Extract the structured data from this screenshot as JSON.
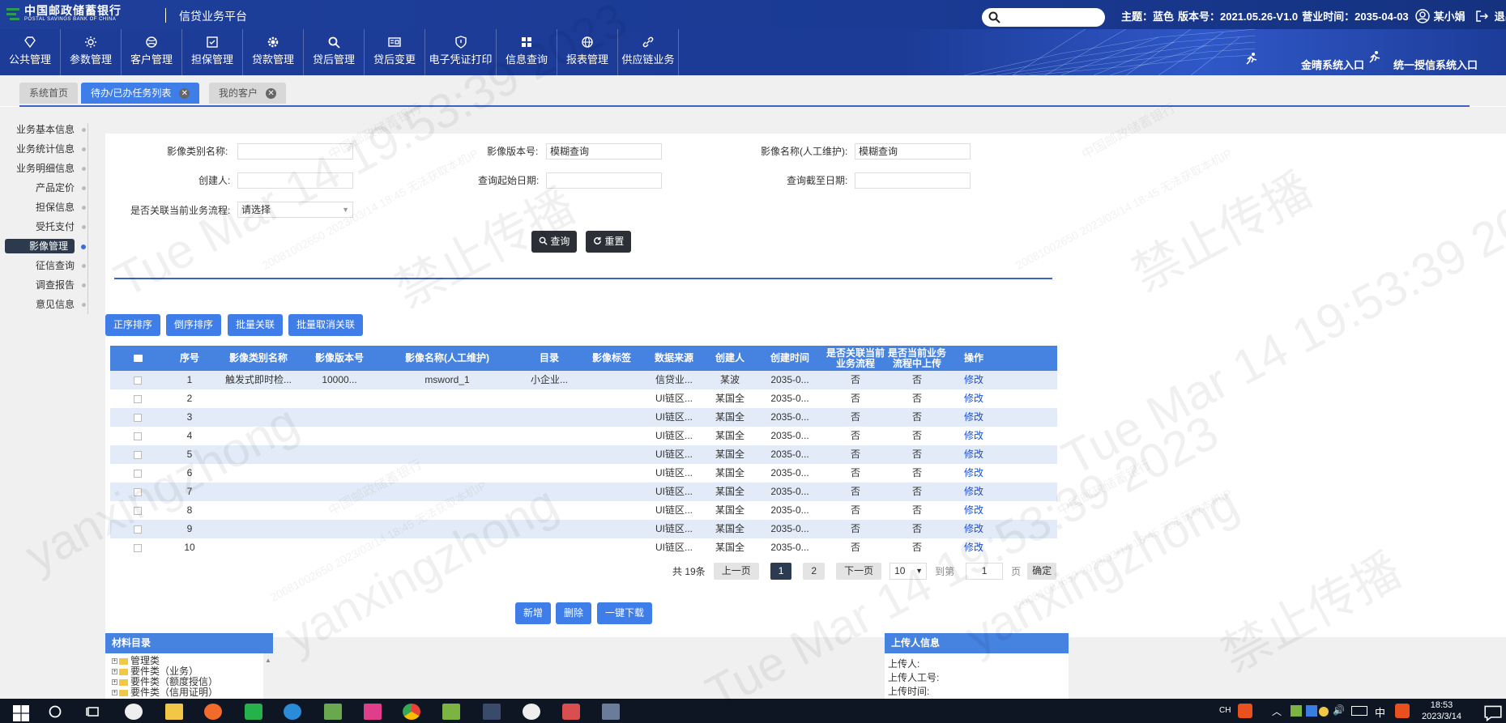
{
  "header": {
    "bank_name_cn": "中国邮政储蓄银行",
    "bank_name_en": "POSTAL SAVINGS BANK OF CHINA",
    "platform": "信贷业务平台",
    "search_placeholder": "",
    "theme": "主题：蓝色",
    "version": "版本号：2021.05.26-V1.0",
    "biz_time": "营业时间：2035-04-03",
    "user": "某小娟",
    "logout": "退出"
  },
  "nav": {
    "items": [
      {
        "label": "公共管理",
        "icon": "diamond-icon"
      },
      {
        "label": "参数管理",
        "icon": "gear-sun-icon"
      },
      {
        "label": "客户管理",
        "icon": "ball-icon"
      },
      {
        "label": "担保管理",
        "icon": "checklist-icon"
      },
      {
        "label": "贷款管理",
        "icon": "gear-icon"
      },
      {
        "label": "贷后管理",
        "icon": "search-icon"
      },
      {
        "label": "贷后变更",
        "icon": "card-icon"
      },
      {
        "label": "电子凭证打印",
        "icon": "shield-icon"
      },
      {
        "label": "信息查询",
        "icon": "grid-icon"
      },
      {
        "label": "报表管理",
        "icon": "globe-icon"
      },
      {
        "label": "供应链业务",
        "icon": "link-icon"
      }
    ],
    "entry1": "金晴系统入口",
    "entry2": "统一授信系统入口"
  },
  "tabs": [
    {
      "label": "系统首页",
      "active": false,
      "closable": false
    },
    {
      "label": "待办/已办任务列表",
      "active": true,
      "closable": true
    },
    {
      "label": "我的客户",
      "active": false,
      "closable": true
    }
  ],
  "sidebar": {
    "items": [
      "业务基本信息",
      "业务统计信息",
      "业务明细信息",
      "产品定价",
      "担保信息",
      "受托支付",
      "影像管理",
      "征信查询",
      "调查报告",
      "意见信息"
    ],
    "active_index": 6
  },
  "form": {
    "label_category": "影像类别名称:",
    "value_category": "",
    "label_version": "影像版本号:",
    "value_version": "模糊查询",
    "label_name": "影像名称(人工维护):",
    "value_name": "模糊查询",
    "label_creator": "创建人:",
    "value_creator": "",
    "label_start": "查询起始日期:",
    "value_start": "",
    "label_end": "查询截至日期:",
    "value_end": "",
    "label_link": "是否关联当前业务流程:",
    "value_link": "请选择",
    "btn_query": "查询",
    "btn_reset": "重置"
  },
  "actions": {
    "asc": "正序排序",
    "desc": "倒序排序",
    "bulk_link": "批量关联",
    "bulk_unlink": "批量取消关联"
  },
  "table": {
    "headers": [
      "序号",
      "影像类别名称",
      "影像版本号",
      "影像名称(人工维护)",
      "目录",
      "影像标签",
      "数据来源",
      "创建人",
      "创建时间",
      "是否关联当前业务流程",
      "是否当前业务流程中上传",
      "操作"
    ],
    "rows": [
      [
        "1",
        "触发式即时检...",
        "10000...",
        "msword_1",
        "小企业...",
        "",
        "信贷业...",
        "某波",
        "2035-0...",
        "否",
        "否",
        "修改"
      ],
      [
        "2",
        "",
        "",
        "",
        "",
        "",
        "UI链区...",
        "某国全",
        "2035-0...",
        "否",
        "否",
        "修改"
      ],
      [
        "3",
        "",
        "",
        "",
        "",
        "",
        "UI链区...",
        "某国全",
        "2035-0...",
        "否",
        "否",
        "修改"
      ],
      [
        "4",
        "",
        "",
        "",
        "",
        "",
        "UI链区...",
        "某国全",
        "2035-0...",
        "否",
        "否",
        "修改"
      ],
      [
        "5",
        "",
        "",
        "",
        "",
        "",
        "UI链区...",
        "某国全",
        "2035-0...",
        "否",
        "否",
        "修改"
      ],
      [
        "6",
        "",
        "",
        "",
        "",
        "",
        "UI链区...",
        "某国全",
        "2035-0...",
        "否",
        "否",
        "修改"
      ],
      [
        "7",
        "",
        "",
        "",
        "",
        "",
        "UI链区...",
        "某国全",
        "2035-0...",
        "否",
        "否",
        "修改"
      ],
      [
        "8",
        "",
        "",
        "",
        "",
        "",
        "UI链区...",
        "某国全",
        "2035-0...",
        "否",
        "否",
        "修改"
      ],
      [
        "9",
        "",
        "",
        "",
        "",
        "",
        "UI链区...",
        "某国全",
        "2035-0...",
        "否",
        "否",
        "修改"
      ],
      [
        "10",
        "",
        "",
        "",
        "",
        "",
        "UI链区...",
        "某国全",
        "2035-0...",
        "否",
        "否",
        "修改"
      ]
    ]
  },
  "pager": {
    "total": "共 19条",
    "prev": "上一页",
    "page1": "1",
    "page2": "2",
    "next": "下一页",
    "size": "10",
    "goto": "到第",
    "goto_value": "1",
    "page_unit": "页",
    "confirm": "确定"
  },
  "bottom_buttons": {
    "add": "新增",
    "delete": "删除",
    "download": "一键下载"
  },
  "material_panel": {
    "title": "材料目录",
    "items": [
      "管理类",
      "要件类（业务）",
      "要件类（额度授信）",
      "要件类（信用证明）"
    ]
  },
  "uploader_panel": {
    "title": "上传人信息",
    "uploader": "上传人:",
    "uploader_id": "上传人工号:",
    "upload_time": "上传时间:"
  },
  "taskbar": {
    "lang": "CH",
    "ime": "中",
    "time": "18:53",
    "date": "2023/3/14"
  },
  "watermark": {
    "line1": "Tue Mar 14 19:53:39 2023",
    "line2": "禁止传播",
    "line3": "yanxingzhong",
    "line4": "中国邮政储蓄银行",
    "line5": "20081002650 2023/03/14 18:45 无法获取本机IP"
  }
}
